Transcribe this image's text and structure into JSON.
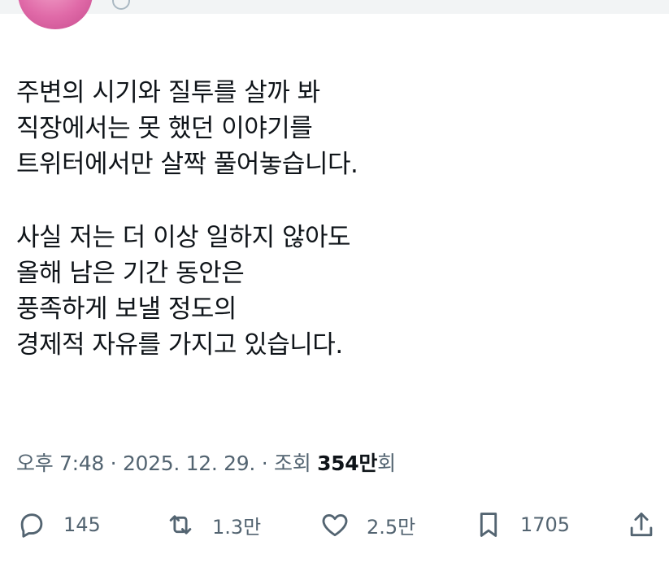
{
  "tweet": {
    "lines": [
      "주변의 시기와 질투를 살까 봐",
      "직장에서는 못 했던 이야기를",
      "트위터에서만 살짝 풀어놓습니다.",
      "사실 저는 더 이상 일하지 않아도",
      "올해 남은 기간 동안은",
      "풍족하게 보낼 정도의",
      "경제적 자유를 가지고 있습니다."
    ]
  },
  "meta": {
    "time": "오후 7:48",
    "separator1": " · ",
    "date": "2025. 12. 29.",
    "separator2": " · ",
    "views_label": "조회 ",
    "views_value": "354만",
    "views_suffix": "회"
  },
  "actions": {
    "replies": "145",
    "retweets": "1.3만",
    "likes": "2.5만",
    "bookmarks": "1705"
  },
  "icons": {
    "reply": "reply-icon",
    "retweet": "retweet-icon",
    "like": "heart-icon",
    "bookmark": "bookmark-icon",
    "share": "share-icon"
  },
  "colors": {
    "text": "#0f1419",
    "secondary": "#536471",
    "avatar": "#e06aa8"
  }
}
